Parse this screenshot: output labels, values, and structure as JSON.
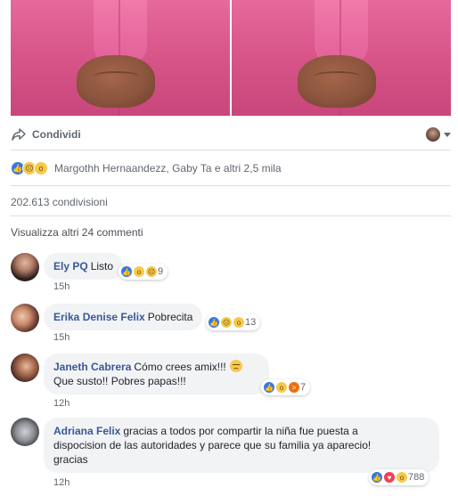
{
  "post": {
    "share_label": "Condividi",
    "reactions_text": "Margothh Hernaandezz, Gaby Ta e altri 2,5 mila",
    "reaction_icons": [
      "like-icon",
      "sad-icon",
      "wow-icon"
    ],
    "shares_text": "202.613 condivisioni",
    "more_comments": "Visualizza altri 24 commenti"
  },
  "comments": [
    {
      "author": "Ely PQ",
      "text": "Listo",
      "reaction_count": "9",
      "reaction_icons": [
        "like-icon",
        "wow-icon",
        "sad-icon"
      ],
      "time": "15h"
    },
    {
      "author": "Erika Denise Felix",
      "text": "Pobrecita",
      "reaction_count": "13",
      "reaction_icons": [
        "like-icon",
        "sad-icon",
        "wow-icon"
      ],
      "time": "15h"
    },
    {
      "author": "Janeth Cabrera",
      "text_line1": "Cómo crees amix!!!",
      "text_line2": "Que susto!! Pobres papas!!!",
      "reaction_count": "7",
      "reaction_icons": [
        "like-icon",
        "wow-icon",
        "angry-icon"
      ],
      "time": "12h"
    },
    {
      "author": "Adriana Felix",
      "text_line1": "gracias a todos por compartir la niña fue puesta a",
      "text_line2": "dispocision de las autoridades y parece que su familia ya aparecio!",
      "text_line3": "gracias",
      "reaction_count": "788",
      "reaction_icons": [
        "like-icon",
        "love-icon",
        "wow-icon"
      ],
      "time": "12h"
    }
  ],
  "colors": {
    "link": "#385898",
    "like": "#3578e5",
    "bubble": "#f2f3f5",
    "muted": "#606770"
  }
}
